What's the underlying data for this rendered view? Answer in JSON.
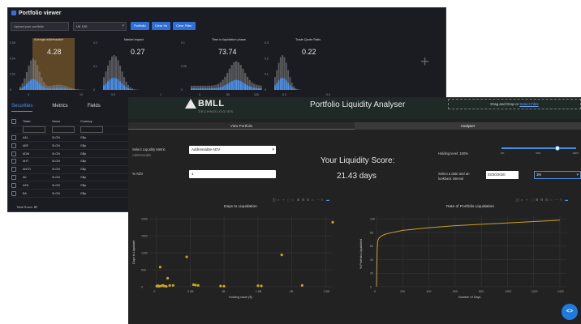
{
  "viewer": {
    "title": "Portfolio viewer",
    "upload_label": "Upload your portfolio",
    "index_select": "UK 100",
    "buttons": [
      "Portfolio",
      "Clear Xs",
      "Clear Filter"
    ],
    "tabs": [
      "Securities",
      "Metrics",
      "Fields"
    ],
    "grid": {
      "headers": [
        "Ticker",
        "Venue",
        "Currency"
      ],
      "rows": [
        [
          "AAL",
          "XLON",
          "GBp"
        ],
        [
          "ABF",
          "XLON",
          "GBp"
        ],
        [
          "ADM",
          "XLON",
          "GBp"
        ],
        [
          "AHT",
          "XLON",
          "GBp"
        ],
        [
          "ANTO",
          "XLON",
          "GBp"
        ],
        [
          "AV.",
          "XLON",
          "GBp"
        ],
        [
          "AZN",
          "XLON",
          "GBp"
        ],
        [
          "BA.",
          "XLON",
          "GBp"
        ]
      ]
    },
    "total_rows_label": "Total Rows:",
    "total_rows_value": "97",
    "histograms": [
      {
        "title": "Average addressable",
        "value": "4.28",
        "yticks": [
          "0.06",
          "0.04",
          "0.02",
          "0"
        ],
        "xticks": [
          "0",
          "10"
        ],
        "color": "#e8a24a"
      },
      {
        "title": "Market impact",
        "value": "0.27",
        "yticks": [
          "0.2",
          "0.1",
          "0"
        ],
        "xticks": [
          "0.5",
          "1"
        ],
        "color": "#4a8fe8"
      },
      {
        "title": "Time in liquidation phase",
        "value": "73.74",
        "yticks": [
          "0.1",
          "0.05",
          "0"
        ],
        "xticks": [
          "0",
          "50",
          "100"
        ],
        "color": "#4a8fe8"
      },
      {
        "title": "Trade Quote Ratio",
        "value": "0.22",
        "yticks": [
          "0.3",
          "0.2",
          "0.1",
          "0"
        ],
        "xticks": [
          "0.2",
          "0.4"
        ],
        "color": "#4a8fe8"
      }
    ]
  },
  "bmll": {
    "brand": "BMLL",
    "brand_sub": "TECHNOLOGIES",
    "title": "Portfolio Liquidity Analyser",
    "drop_text": "Drag and Drop or",
    "drop_link": "Select Files",
    "tabs": [
      "View Portfolio",
      "Analyser"
    ],
    "metric_label": "Select Liquidity Metric",
    "metric_sublabel": "Addressable",
    "metric_value": "Addressable ADV",
    "x_label": "% ADV",
    "x_value": "1",
    "score_label": "Your Liquidity Score:",
    "score_value": "21.43 days",
    "holding_label": "Holding level: 100%",
    "slider_ticks": [
      "0%",
      "50%",
      "100%"
    ],
    "slider_value": 75,
    "date_label": "Select a date and an lookback interval",
    "date_value": "03/30/2020",
    "period_value": "3M",
    "chart_left_title": "Days to Liquidation",
    "chart_right_title": "Rate of Portfolio Liquidation"
  },
  "chart_data": [
    {
      "type": "scatter",
      "title": "Days to Liquidation",
      "xlabel": "Holding value ($)",
      "ylabel": "Days to Liquidate",
      "x_tick_labels": [
        "0",
        "0.5B",
        "1B",
        "1.5B",
        "2B",
        "2.5B"
      ],
      "y_tick_labels": [
        "0",
        "500",
        "1000",
        "1500",
        "2000"
      ],
      "xlim": [
        -0.1,
        2.6
      ],
      "ylim": [
        0,
        2100
      ],
      "points": [
        [
          0.01,
          20
        ],
        [
          0.02,
          10
        ],
        [
          0.03,
          30
        ],
        [
          0.05,
          15
        ],
        [
          0.06,
          580
        ],
        [
          0.08,
          25
        ],
        [
          0.1,
          40
        ],
        [
          0.12,
          20
        ],
        [
          0.15,
          10
        ],
        [
          0.17,
          250
        ],
        [
          0.2,
          35
        ],
        [
          0.25,
          40
        ],
        [
          0.45,
          880
        ],
        [
          0.55,
          60
        ],
        [
          0.58,
          50
        ],
        [
          0.62,
          40
        ],
        [
          0.95,
          20
        ],
        [
          1.0,
          15
        ],
        [
          1.5,
          30
        ],
        [
          1.55,
          25
        ],
        [
          1.85,
          940
        ],
        [
          2.15,
          40
        ],
        [
          2.6,
          1900
        ]
      ],
      "color": "#c9a227"
    },
    {
      "type": "line",
      "title": "Rate of Portfolio Liquidation",
      "xlabel": "Number of Days",
      "ylabel": "% Portfolio Liquidated",
      "x_tick_labels": [
        "0",
        "200",
        "400",
        "600",
        "800",
        "1000",
        "1200",
        "1400"
      ],
      "y_tick_labels": [
        "0",
        "20",
        "40",
        "60",
        "80",
        "100"
      ],
      "xlim": [
        0,
        1450
      ],
      "ylim": [
        0,
        105
      ],
      "x": [
        0,
        5,
        10,
        20,
        40,
        60,
        100,
        150,
        200,
        300,
        400,
        600,
        800,
        1000,
        1200,
        1400
      ],
      "y": [
        0,
        55,
        68,
        72,
        75,
        77,
        79,
        81,
        83,
        85,
        87,
        90,
        92,
        94,
        96,
        98
      ],
      "color": "#c9a227"
    }
  ]
}
